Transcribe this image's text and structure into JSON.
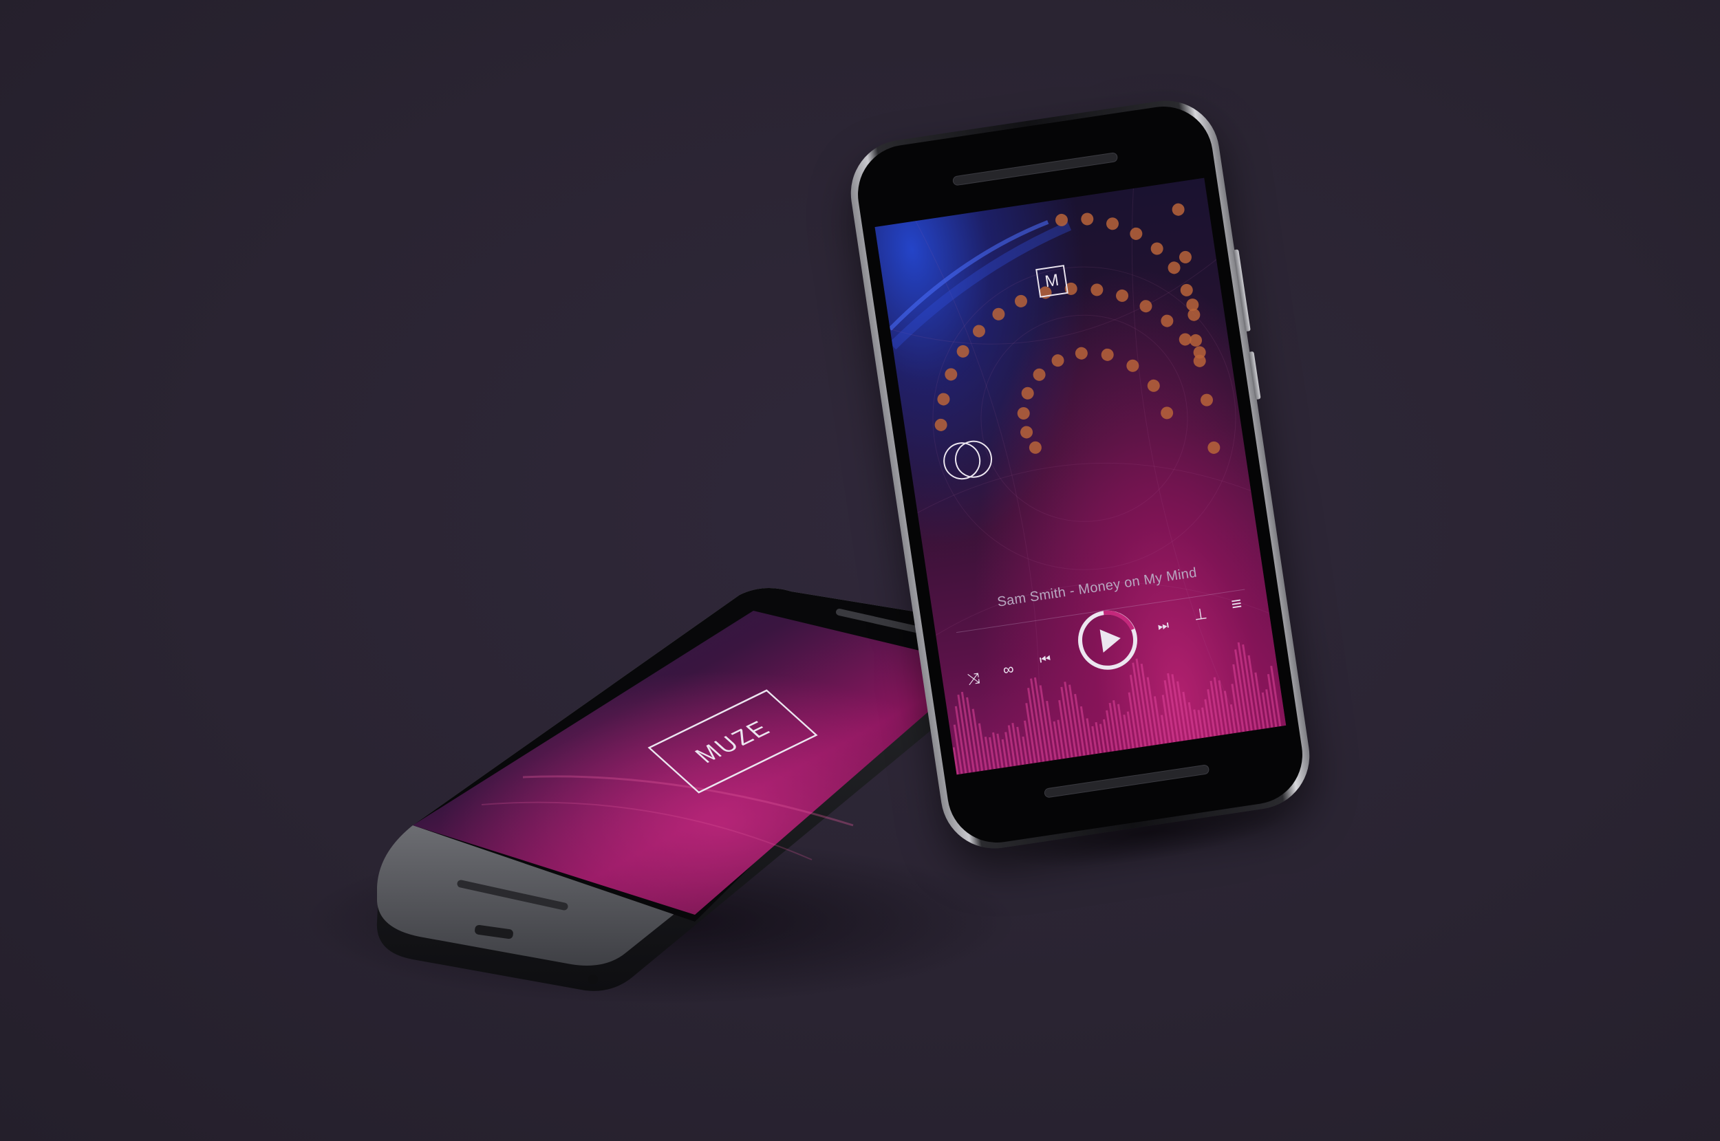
{
  "splash": {
    "brand": "MUZE"
  },
  "player": {
    "logo_letter": "M",
    "track_title": "Sam Smith - Money on My Mind",
    "controls": {
      "shuffle_glyph": "⤨",
      "effects_glyph": "∞",
      "previous_glyph": "⏮",
      "next_glyph": "⏭",
      "download_glyph": "⊥",
      "menu_glyph": "≡"
    }
  },
  "colors": {
    "background": "#2a2432",
    "accent_magenta": "#c4287c",
    "accent_blue": "#2444c8",
    "dot_orange": "#b8643a",
    "text_light": "#ece6f0"
  }
}
